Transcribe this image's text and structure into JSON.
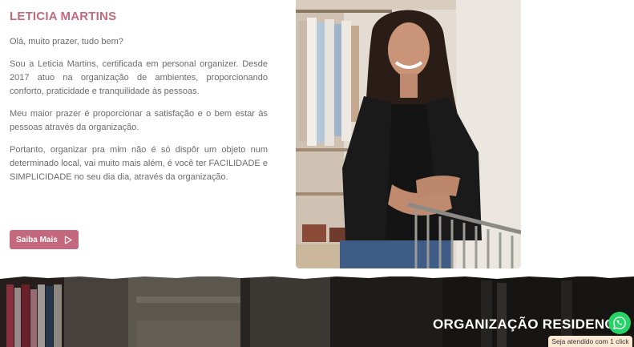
{
  "about": {
    "title": "LETICIA MARTINS",
    "paragraphs": [
      "Olá, muito prazer, tudo bem?",
      "Sou a Leticia Martins, certificada em personal organizer. Desde 2017 atuo na organização de ambientes, proporcionando conforto, praticidade e tranquilidade às pessoas.",
      "Meu maior prazer é proporcionar a satisfação e o bem estar às pessoas através da organização.",
      "Portanto, organizar pra mim não é só dispôr um objeto num determinado local, vai muito mais além, é você ter FACILIDADE e SIMPLICIDADE no seu dia dia, através da organização."
    ],
    "cta_label": "Saiba Mais",
    "cta_icon": "play-outline-icon"
  },
  "banner": {
    "title": "ORGANIZAÇÃO RESIDENCI"
  },
  "whatsapp": {
    "icon": "whatsapp-icon",
    "tooltip": "Seja atendido com 1 click"
  },
  "colors": {
    "accent": "#c4687e",
    "text": "#6b6b6b",
    "whatsapp": "#25d366",
    "tooltip_bg": "#fde8d4"
  }
}
